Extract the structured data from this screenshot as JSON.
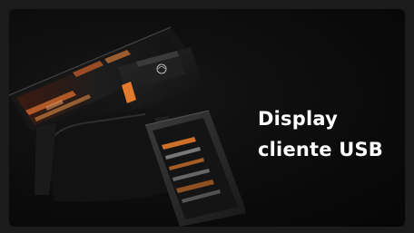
{
  "caption": {
    "line1": "Display",
    "line2": "cliente USB"
  },
  "image": {
    "subject": "pos-terminal-with-customer-display",
    "accent_color": "#e27a2c"
  }
}
